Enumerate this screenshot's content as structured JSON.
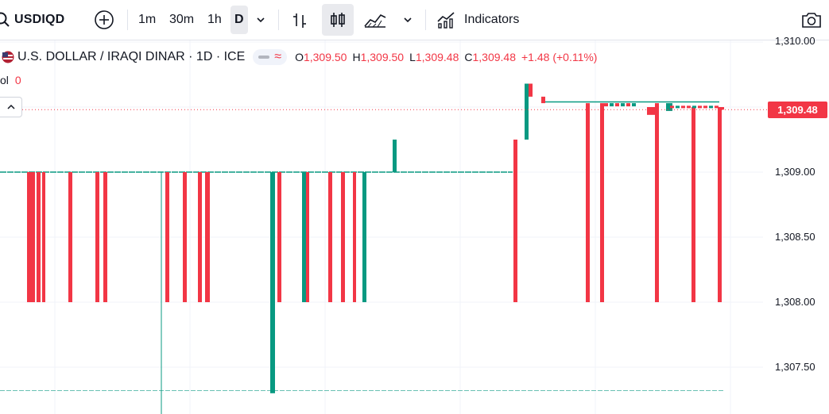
{
  "toolbar": {
    "symbol": "USDIQD",
    "timeframes": [
      "1m",
      "30m",
      "1h",
      "D"
    ],
    "active_timeframe": "D",
    "indicators_label": "Indicators"
  },
  "legend": {
    "title": "U.S. DOLLAR / IRAQI DINAR · 1D · ICE",
    "open_label": "O",
    "open": "1,309.50",
    "high_label": "H",
    "high": "1,309.50",
    "low_label": "L",
    "low": "1,309.48",
    "close_label": "C",
    "close": "1,309.48",
    "change": "+1.48 (+0.11%)"
  },
  "volume": {
    "label": "ol",
    "value": "0"
  },
  "price_axis": {
    "labels": [
      "1,310.00",
      "1,309.00",
      "1,308.50",
      "1,308.00",
      "1,307.50"
    ],
    "last_price": "1,309.48"
  },
  "colors": {
    "up": "#089981",
    "down": "#f23645",
    "accent": "#f23645"
  },
  "chart_data": {
    "type": "candlestick",
    "y_range": [
      1307.32,
      1310.03
    ],
    "last_price": 1309.48,
    "candles": [
      {
        "dir": "down",
        "open": 1309.0,
        "close": 1308.0
      },
      {
        "dir": "down",
        "open": 1309.0,
        "close": 1308.0
      },
      {
        "dir": "down",
        "open": 1309.0,
        "close": 1308.0
      },
      {
        "dir": "down",
        "open": 1309.0,
        "close": 1308.0
      },
      {
        "dir": "down",
        "open": 1309.0,
        "close": 1308.0
      },
      {
        "dir": "down",
        "open": 1309.0,
        "close": 1308.0
      },
      {
        "dir": "down",
        "open": 1309.0,
        "close": 1308.0
      },
      {
        "dir": "down",
        "open": 1309.0,
        "close": 1308.0
      },
      {
        "dir": "down",
        "open": 1309.0,
        "close": 1308.0
      },
      {
        "dir": "down",
        "open": 1309.0,
        "close": 1308.0
      },
      {
        "dir": "down",
        "open": 1309.0,
        "close": 1308.0
      },
      {
        "dir": "up",
        "open": 1307.3,
        "close": 1309.0
      },
      {
        "dir": "down",
        "open": 1309.0,
        "close": 1308.0
      },
      {
        "dir": "up",
        "open": 1308.0,
        "close": 1309.0
      },
      {
        "dir": "down",
        "open": 1309.0,
        "close": 1308.0
      },
      {
        "dir": "down",
        "open": 1309.0,
        "close": 1308.0
      },
      {
        "dir": "down",
        "open": 1309.0,
        "close": 1308.0
      },
      {
        "dir": "down",
        "open": 1309.0,
        "close": 1308.0
      },
      {
        "dir": "up",
        "open": 1308.0,
        "close": 1309.0
      },
      {
        "dir": "up",
        "open": 1309.0,
        "close": 1309.25
      },
      {
        "dir": "down",
        "open": 1309.25,
        "close": 1308.0
      },
      {
        "dir": "up",
        "open": 1309.25,
        "close": 1309.68
      },
      {
        "dir": "down",
        "open": 1309.68,
        "close": 1309.58
      },
      {
        "dir": "down",
        "open": 1309.58,
        "close": 1309.53
      },
      {
        "dir": "down",
        "open": 1309.53,
        "close": 1308.0
      },
      {
        "dir": "down",
        "open": 1309.53,
        "close": 1308.0
      },
      {
        "dir": "down",
        "open": 1309.53,
        "close": 1308.0
      },
      {
        "dir": "down",
        "open": 1309.5,
        "close": 1309.44
      },
      {
        "dir": "up",
        "open": 1309.47,
        "close": 1309.53
      },
      {
        "dir": "down",
        "open": 1309.5,
        "close": 1308.0
      },
      {
        "dir": "down",
        "open": 1309.5,
        "close": 1308.0
      },
      {
        "dir": "down",
        "open": 1309.5,
        "close": 1309.48
      }
    ]
  }
}
